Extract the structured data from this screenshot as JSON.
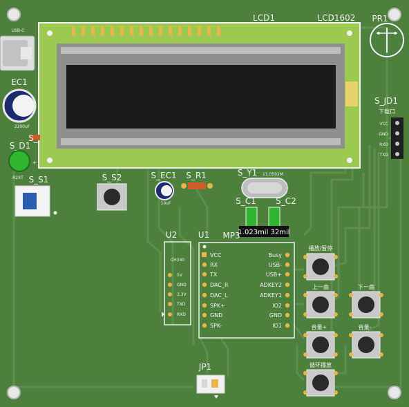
{
  "colors": {
    "board": "#4d7f3d",
    "trace": "#5f8f4e",
    "silkscreen": "#f2f2f2",
    "lcd_frame": "#9cc94f",
    "lcd_screen": "#1b1b1b",
    "led": "#2fb52f",
    "switch": "#2a5db0",
    "crystal_label": "#ffe066",
    "tooltip_bg": "#111111"
  },
  "labels": {
    "lcd_ref": "LCD1",
    "lcd_model": "LCD1602",
    "pr1": "PR1",
    "ec1": "EC1",
    "ec1_value": "2200uF",
    "s_r_partial": "S_",
    "s_d1": "S_D1",
    "s_d1_sub": "R2XT",
    "s_s1": "S_S1",
    "s_s2": "S_S2",
    "s_ec1": "S_EC1",
    "s_ec1_value": "10uF",
    "s_r1": "S_R1",
    "s_y1": "S_Y1",
    "s_y1_value": "11.0592M",
    "s_c1": "S_C1",
    "s_c2": "S_C2",
    "s_jd1": "S_JD1",
    "s_jd1_title": "下载口",
    "u2": "U2",
    "u2_module": "CH340",
    "u1": "U1",
    "mp3": "MP3",
    "jp1": "JP1",
    "plus_mark": "+",
    "btn_play_pause": "播放/暂停",
    "btn_prev": "上一曲",
    "btn_next": "下一曲",
    "btn_vol_up": "音量+",
    "btn_vol_down": "音量-",
    "btn_loop": "循环播放"
  },
  "tooltip": "1.023mil 32mil",
  "jd1_pins": [
    "VCC",
    "GND",
    "RXD",
    "TXD"
  ],
  "u2_pins": [
    "5V",
    "GND",
    "3.3V",
    "TXD",
    "RXD"
  ],
  "u1_left_pins": [
    "VCC",
    "RX",
    "TX",
    "DAC_R",
    "DAC_L",
    "SPK+",
    "GND",
    "SPK-"
  ],
  "u1_right_pins": [
    "Busy",
    "USB-",
    "USB+",
    "ADKEY2",
    "ADKEY1",
    "IO2",
    "GND",
    "IO1"
  ]
}
